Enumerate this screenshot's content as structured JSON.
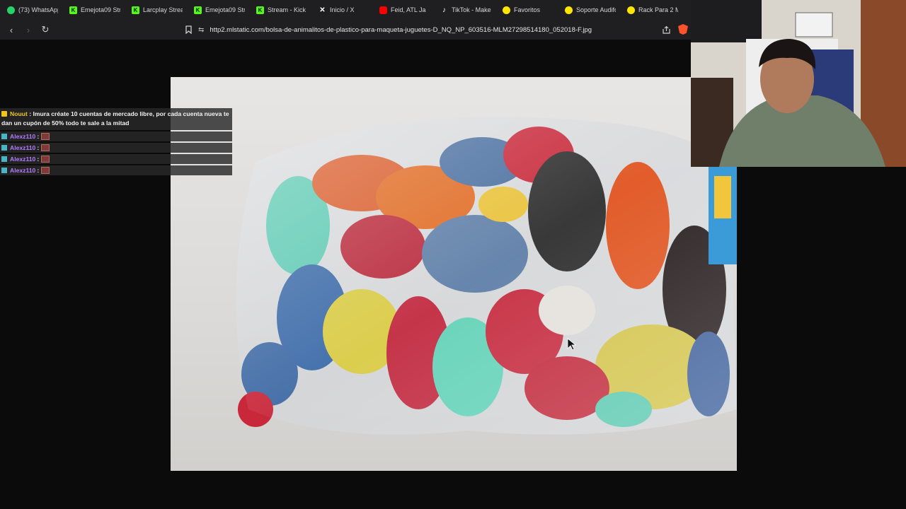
{
  "bookmarks": [
    {
      "label": "(73) WhatsApp",
      "icon": "whatsapp-icon",
      "color": "#25d366"
    },
    {
      "label": "Emejota09 Stre",
      "icon": "kick-icon",
      "color": "#53fc18"
    },
    {
      "label": "Larcplay Stream",
      "icon": "kick-icon",
      "color": "#53fc18"
    },
    {
      "label": "Emejota09 Stre",
      "icon": "kick-icon",
      "color": "#53fc18"
    },
    {
      "label": "Stream - Kick D",
      "icon": "kick-icon",
      "color": "#53fc18"
    },
    {
      "label": "Inicio / X",
      "icon": "x-icon",
      "color": "#ffffff"
    },
    {
      "label": "Feid, ATL Ja",
      "icon": "youtube-icon",
      "color": "#ff0000"
    },
    {
      "label": "TikTok - Make",
      "icon": "tiktok-icon",
      "color": "#ffffff"
    },
    {
      "label": "Favoritos",
      "icon": "mercadolibre-icon",
      "color": "#ffe600"
    },
    {
      "label": "Soporte Audifo",
      "icon": "mercadolibre-icon",
      "color": "#ffe600"
    },
    {
      "label": "Rack Para 2 Mo",
      "icon": "mercadolibre-icon",
      "color": "#ffe600"
    }
  ],
  "address_bar": {
    "url": "http2.mlstatic.com/bolsa-de-animalitos-de-plastico-para-maqueta-juguetes-D_NQ_NP_603516-MLM27298514180_052018-F.jpg"
  },
  "chat": {
    "first": {
      "user": "Nouut",
      "message": ": lmura créate 10 cuentas de mercado libre, por cada cuenta nueva te dan un cupón de 50% todo te sale a la mitad"
    },
    "lines": [
      {
        "user": "Alexz110",
        "sep": ":"
      },
      {
        "user": "Alexz110",
        "sep": ":"
      },
      {
        "user": "Alexz110",
        "sep": ":"
      },
      {
        "user": "Alexz110",
        "sep": ":"
      }
    ]
  },
  "colors": {
    "background": "#0b0b0c",
    "toolbar": "#1f1f22",
    "chat_user_gold": "#f0c419",
    "chat_user_purple": "#b37bff"
  }
}
